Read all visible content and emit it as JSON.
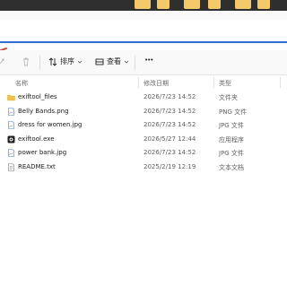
{
  "command_bar": {
    "sort_label": "排序",
    "view_label": "查看",
    "more_label": "•••"
  },
  "columns": {
    "name": "名称",
    "modified": "修改日期",
    "type": "类型"
  },
  "files": [
    {
      "name": "exiftool_files",
      "modified": "2026/7/23 14:52",
      "type": "文件夹",
      "icon": "folder-icon"
    },
    {
      "name": "Belly Bands.png",
      "modified": "2026/7/23 14:52",
      "type": "PNG 文件",
      "icon": "image-file-icon"
    },
    {
      "name": "dress for women.jpg",
      "modified": "2026/7/23 14:52",
      "type": "JPG 文件",
      "icon": "image-file-icon"
    },
    {
      "name": "exiftool.exe",
      "modified": "2026/5/27 12:44",
      "type": "应用程序",
      "icon": "exe-app-icon"
    },
    {
      "name": "power bank.jpg",
      "modified": "2026/7/23 14:52",
      "type": "JPG 文件",
      "icon": "image-file-icon"
    },
    {
      "name": "README.txt",
      "modified": "2025/2/19 12:19",
      "type": "文本文档",
      "icon": "text-file-icon"
    }
  ],
  "colors": {
    "accent": "#2f6fd1",
    "folder": "#f4c24a",
    "taskbar": "#2f2f2f"
  }
}
